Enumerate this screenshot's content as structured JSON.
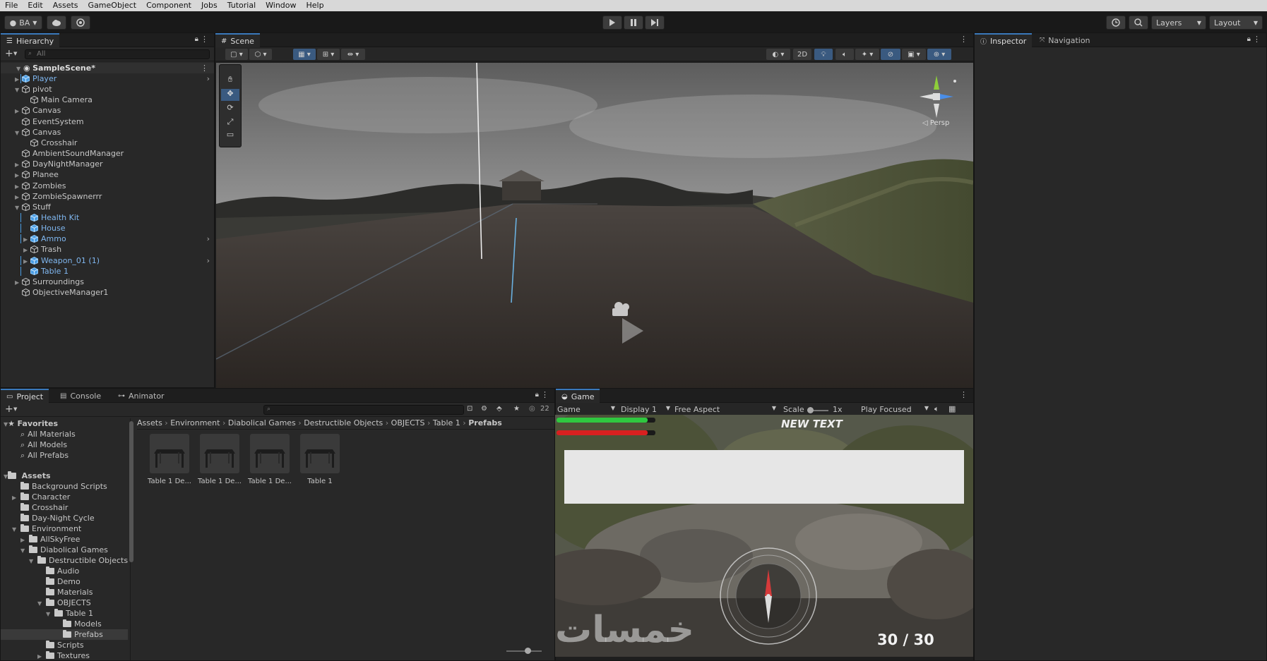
{
  "menu": [
    "File",
    "Edit",
    "Assets",
    "GameObject",
    "Component",
    "Jobs",
    "Tutorial",
    "Window",
    "Help"
  ],
  "toolbar": {
    "account": "BA",
    "layers": "Layers",
    "layout": "Layout"
  },
  "hierarchy": {
    "tab": "Hierarchy",
    "search_placeholder": "All",
    "scene": "SampleScene*",
    "items": [
      {
        "label": "Player",
        "depth": 1,
        "arrow": "▶",
        "blue": true
      },
      {
        "label": "pivot",
        "depth": 1,
        "arrow": "▼",
        "blue": false
      },
      {
        "label": "Main Camera",
        "depth": 2,
        "arrow": "",
        "blue": false
      },
      {
        "label": "Canvas",
        "depth": 1,
        "arrow": "▶",
        "blue": false
      },
      {
        "label": "EventSystem",
        "depth": 1,
        "arrow": "",
        "blue": false
      },
      {
        "label": "Canvas",
        "depth": 1,
        "arrow": "▼",
        "blue": false
      },
      {
        "label": "Crosshair",
        "depth": 2,
        "arrow": "",
        "blue": false
      },
      {
        "label": "AmbientSoundManager",
        "depth": 1,
        "arrow": "",
        "blue": false
      },
      {
        "label": "DayNightManager",
        "depth": 1,
        "arrow": "▶",
        "blue": false
      },
      {
        "label": "Planee",
        "depth": 1,
        "arrow": "▶",
        "blue": false
      },
      {
        "label": "Zombies",
        "depth": 1,
        "arrow": "▶",
        "blue": false
      },
      {
        "label": "ZombieSpawnerrr",
        "depth": 1,
        "arrow": "▶",
        "blue": false
      },
      {
        "label": "Stuff",
        "depth": 1,
        "arrow": "▼",
        "blue": false
      },
      {
        "label": "Health Kit",
        "depth": 2,
        "arrow": "",
        "blue": true
      },
      {
        "label": "House",
        "depth": 2,
        "arrow": "",
        "blue": true
      },
      {
        "label": "Ammo",
        "depth": 2,
        "arrow": "▶",
        "blue": true
      },
      {
        "label": "Trash",
        "depth": 2,
        "arrow": "▶",
        "blue": false
      },
      {
        "label": "Weapon_01 (1)",
        "depth": 2,
        "arrow": "▶",
        "blue": true
      },
      {
        "label": "Table 1",
        "depth": 2,
        "arrow": "",
        "blue": true
      },
      {
        "label": "Surroundings",
        "depth": 1,
        "arrow": "▶",
        "blue": false
      },
      {
        "label": "ObjectiveManager1",
        "depth": 1,
        "arrow": "",
        "blue": false
      }
    ]
  },
  "scene": {
    "tab": "Scene",
    "btn_2d": "2D",
    "gizmo_persp": "◁ Persp"
  },
  "inspector": {
    "tab": "Inspector",
    "nav_tab": "Navigation"
  },
  "project": {
    "tabs": [
      "Project",
      "Console",
      "Animator"
    ],
    "hidden_count": "22",
    "favorites_label": "Favorites",
    "favorites": [
      "All Materials",
      "All Models",
      "All Prefabs"
    ],
    "assets_label": "Assets",
    "folders": [
      {
        "label": "Background Scripts",
        "depth": 1,
        "arrow": ""
      },
      {
        "label": "Character",
        "depth": 1,
        "arrow": "▶"
      },
      {
        "label": "Crosshair",
        "depth": 1,
        "arrow": ""
      },
      {
        "label": "Day-Night Cycle",
        "depth": 1,
        "arrow": ""
      },
      {
        "label": "Environment",
        "depth": 1,
        "arrow": "▼"
      },
      {
        "label": "AllSkyFree",
        "depth": 2,
        "arrow": "▶"
      },
      {
        "label": "Diabolical Games",
        "depth": 2,
        "arrow": "▼"
      },
      {
        "label": "Destructible Objects",
        "depth": 3,
        "arrow": "▼"
      },
      {
        "label": "Audio",
        "depth": 4,
        "arrow": ""
      },
      {
        "label": "Demo",
        "depth": 4,
        "arrow": ""
      },
      {
        "label": "Materials",
        "depth": 4,
        "arrow": ""
      },
      {
        "label": "OBJECTS",
        "depth": 4,
        "arrow": "▼"
      },
      {
        "label": "Table 1",
        "depth": 5,
        "arrow": "▼"
      },
      {
        "label": "Models",
        "depth": 6,
        "arrow": ""
      },
      {
        "label": "Prefabs",
        "depth": 6,
        "arrow": "",
        "selected": true
      },
      {
        "label": "Scripts",
        "depth": 4,
        "arrow": ""
      },
      {
        "label": "Textures",
        "depth": 4,
        "arrow": "▶"
      }
    ],
    "breadcrumb": [
      "Assets",
      "Environment",
      "Diabolical Games",
      "Destructible Objects",
      "OBJECTS",
      "Table 1",
      "Prefabs"
    ],
    "assets": [
      "Table 1 De...",
      "Table 1 De...",
      "Table 1 De...",
      "Table 1"
    ]
  },
  "game": {
    "tab": "Game",
    "mode": "Game",
    "display": "Display 1",
    "aspect": "Free Aspect",
    "scale_label": "Scale",
    "scale_value": "1x",
    "play_focused": "Play Focused",
    "hud_text": "NEW TEXT",
    "ammo": "30 / 30",
    "watermark": "خمسات",
    "health_fill": 0.92,
    "stamina_fill": 0.92
  }
}
